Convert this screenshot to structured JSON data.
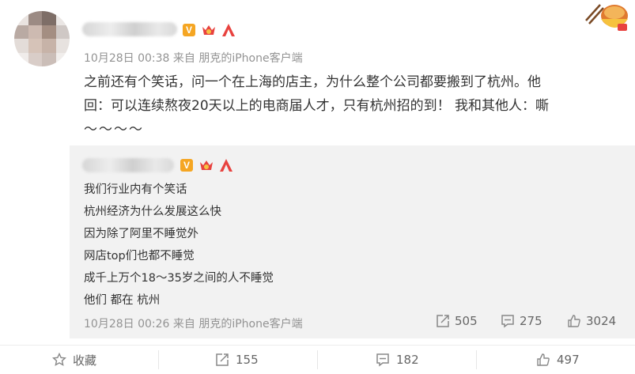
{
  "post": {
    "meta": "10月28日 00:38 来自 朋克的iPhone客户端",
    "text_line1": "之前还有个笑话，问一个在上海的店主，为什么整个公司都要搬到了杭州。他",
    "text_line2": "回：可以连续熬夜20天以上的电商届人才，只有杭州招的到！   我和其他人：嘶",
    "text_line3": "～～～～"
  },
  "reply": {
    "lines": [
      "我们行业内有个笑话",
      "杭州经济为什么发展这么快",
      "因为除了阿里不睡觉外",
      "网店top们也都不睡觉",
      "成千上万个18～35岁之间的人不睡觉",
      "他们 都在 杭州"
    ],
    "meta": "10月28日 00:26 来自 朋克的iPhone客户端",
    "repost_count": "505",
    "comment_count": "275",
    "like_count": "3024"
  },
  "actions": {
    "favorite_label": "收藏",
    "repost_count": "155",
    "comment_count": "182",
    "like_count": "497"
  },
  "badges": {
    "v_label": "V"
  },
  "colors": {
    "accent": "#f5a623",
    "badge_red": "#e8423f",
    "reply_bg": "#f2f2f2"
  }
}
